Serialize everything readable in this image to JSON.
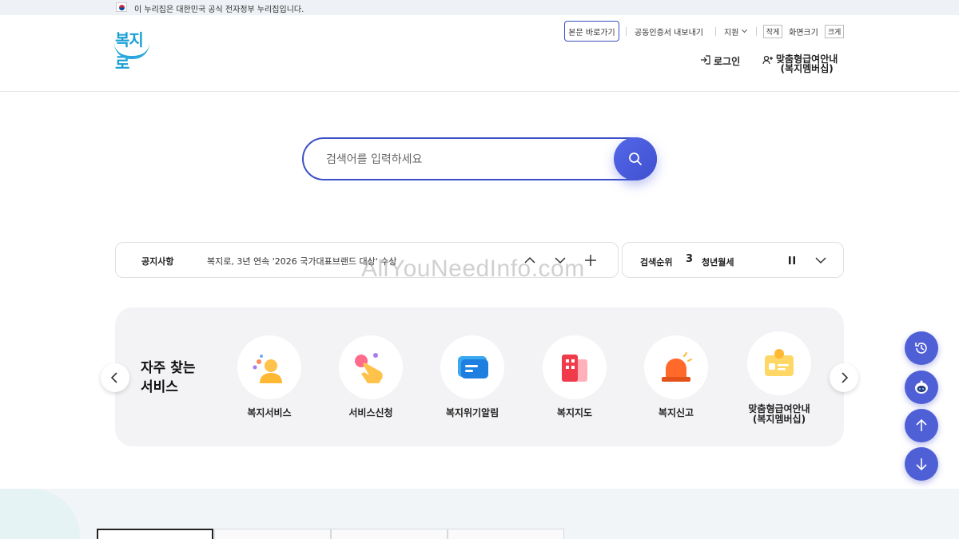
{
  "gov_banner": {
    "text": "이 누리집은 대한민국 공식 전자정부 누리집입니다."
  },
  "logo": {
    "text": "복지로"
  },
  "util": {
    "skip": "본문 바로가기",
    "cert": "공동인증서 내보내기",
    "support": "지원",
    "size_small": "작게",
    "size_label": "화면크기",
    "size_large": "크게"
  },
  "nav": {
    "login": "로그인",
    "member_line1": "맞춤형급여안내",
    "member_line2": "(복지멤버십)"
  },
  "search": {
    "placeholder": "검색어를 입력하세요"
  },
  "notice": {
    "title": "공지사항",
    "text": "복지로, 3년 연속 '2026 국가대표브랜드 대상' 수상"
  },
  "rank": {
    "title": "검색순위",
    "number": "3",
    "keyword": "청년월세"
  },
  "watermark": "AllYouNeedInfo.com",
  "services": {
    "heading_line1": "자주 찾는",
    "heading_line2": "서비스",
    "items": [
      {
        "label": "복지서비스",
        "icon": "person-icon"
      },
      {
        "label": "서비스신청",
        "icon": "tap-hand-icon"
      },
      {
        "label": "복지위기알림",
        "icon": "message-icon"
      },
      {
        "label": "복지지도",
        "icon": "building-icon"
      },
      {
        "label": "복지신고",
        "icon": "siren-icon"
      },
      {
        "label_line1": "맞춤형급여안내",
        "label_line2": "(복지멤버십)",
        "icon": "member-card-icon"
      }
    ]
  },
  "colors": {
    "accent": "#3c4fc6",
    "floating": "#4f5fd6"
  }
}
